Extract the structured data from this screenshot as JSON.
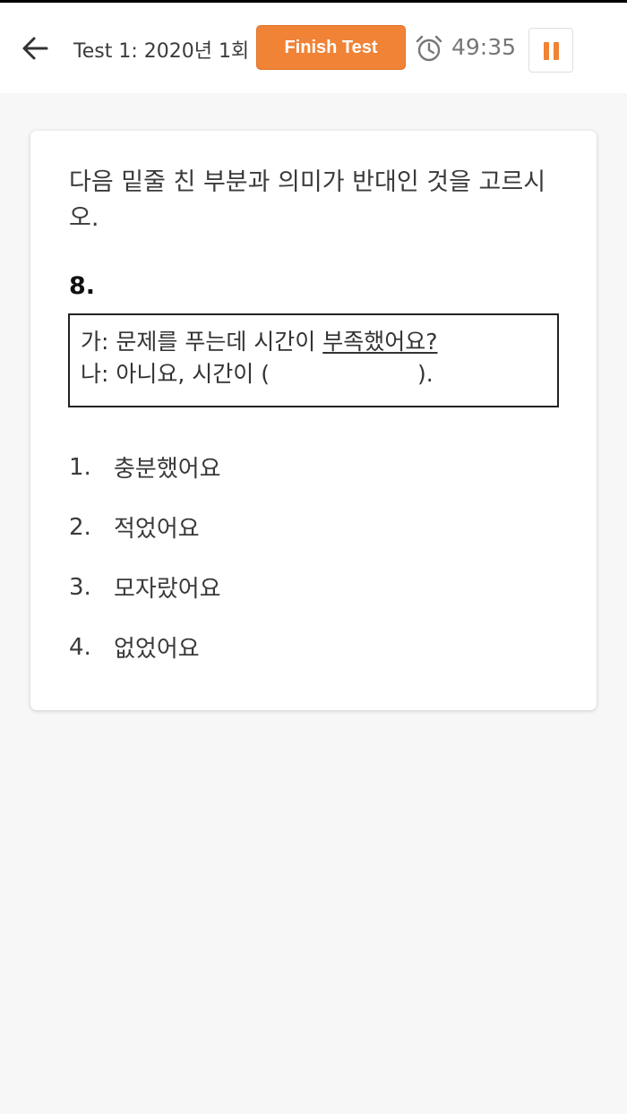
{
  "header": {
    "test_title": "Test 1: 2020년 1회",
    "finish_label": "Finish Test",
    "timer": "49:35"
  },
  "colors": {
    "accent": "#f08336",
    "background": "#f7f7f7",
    "card": "#ffffff"
  },
  "icons": {
    "back": "arrow-left-icon",
    "timer": "alarm-clock-icon",
    "pause": "pause-icon"
  },
  "question": {
    "instruction": "다음 밑줄 친 부분과 의미가 반대인 것을 고르시오.",
    "number": "8.",
    "dialog": {
      "line1_prefix": "가: 문제를 푸는데 시간이 ",
      "line1_underlined": "부족했어요?",
      "line2_prefix": "나: 아니요, 시간이 (",
      "line2_suffix": ")."
    },
    "options": [
      {
        "num": "1.",
        "text": "충분했어요"
      },
      {
        "num": "2.",
        "text": "적었어요"
      },
      {
        "num": "3.",
        "text": "모자랐어요"
      },
      {
        "num": "4.",
        "text": "없었어요"
      }
    ]
  }
}
